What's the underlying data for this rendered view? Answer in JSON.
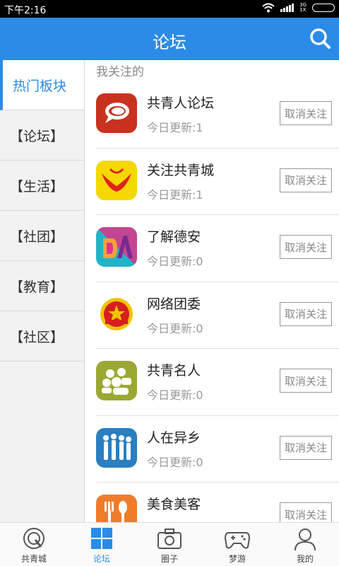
{
  "status": {
    "time": "下午2:16",
    "net": "3G",
    "net2": "1X"
  },
  "header": {
    "title": "论坛"
  },
  "sidebar": {
    "items": [
      {
        "label": "热门板块"
      },
      {
        "label": "【论坛】"
      },
      {
        "label": "【生活】"
      },
      {
        "label": "【社团】"
      },
      {
        "label": "【教育】"
      },
      {
        "label": "【社区】"
      }
    ]
  },
  "main": {
    "section_title": "我关注的",
    "forums": [
      {
        "name": "共青人论坛",
        "update": "今日更新:1",
        "button": "取消关注",
        "icon": "chat-bubble-icon",
        "color": "#c8321e"
      },
      {
        "name": "关注共青城",
        "update": "今日更新:1",
        "button": "取消关注",
        "icon": "phoenix-icon",
        "color": "#f5d800"
      },
      {
        "name": "了解德安",
        "update": "今日更新:0",
        "button": "取消关注",
        "icon": "da-logo-icon",
        "color": "#1fb5c9"
      },
      {
        "name": "网络团委",
        "update": "今日更新:0",
        "button": "取消关注",
        "icon": "youth-league-emblem-icon",
        "color": "#d71f1f"
      },
      {
        "name": "共青名人",
        "update": "今日更新:0",
        "button": "取消关注",
        "icon": "people-icon",
        "color": "#9ba832"
      },
      {
        "name": "人在异乡",
        "update": "今日更新:0",
        "button": "取消关注",
        "icon": "silhouettes-icon",
        "color": "#2a7fc0"
      },
      {
        "name": "美食美客",
        "update": "",
        "button": "取消关注",
        "icon": "cutlery-icon",
        "color": "#f07c2a"
      }
    ]
  },
  "bottom_nav": {
    "items": [
      {
        "label": "共青城"
      },
      {
        "label": "论坛"
      },
      {
        "label": "圈子"
      },
      {
        "label": "梦游"
      },
      {
        "label": "我的"
      }
    ]
  },
  "colors": {
    "accent": "#2b8be6"
  }
}
